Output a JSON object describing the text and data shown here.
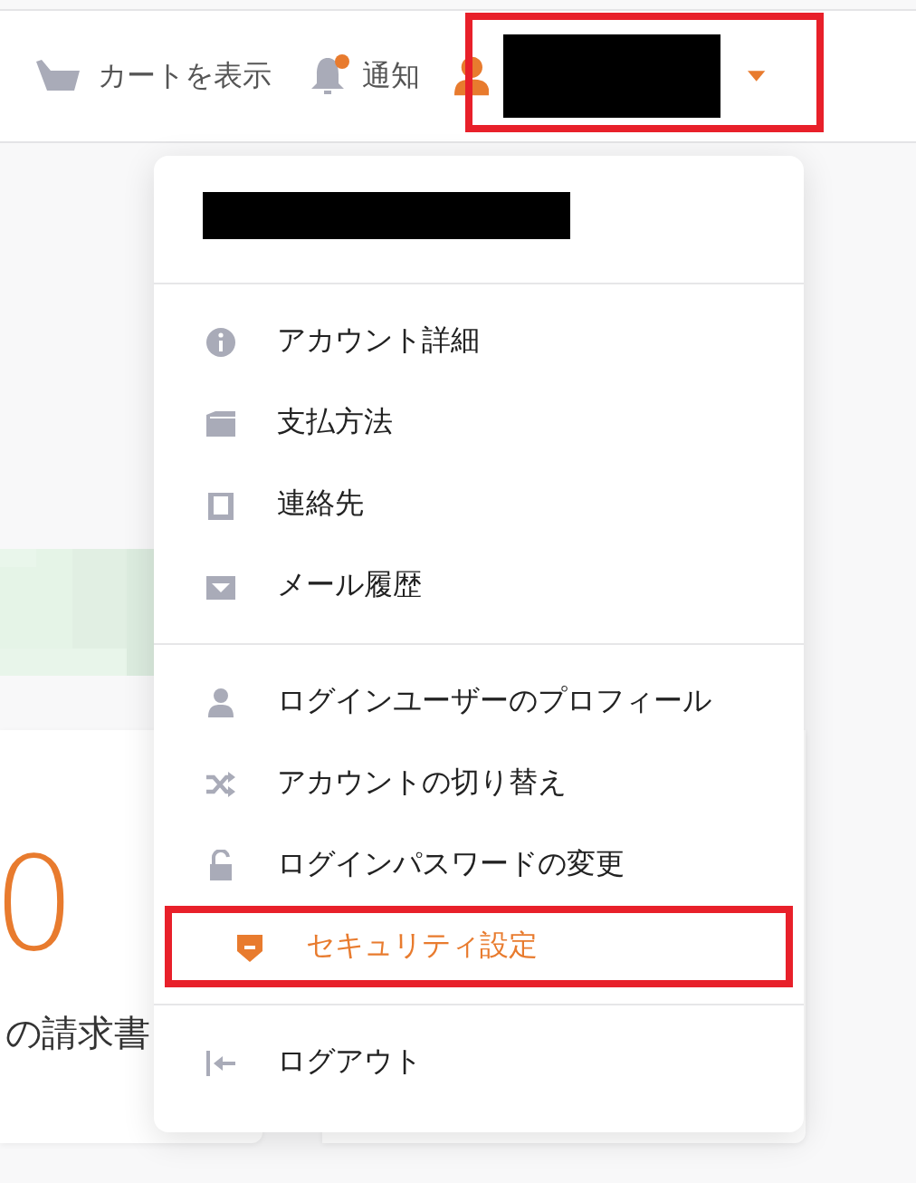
{
  "top_bar": {
    "cart": {
      "label": "カートを表示"
    },
    "notifications": {
      "label": "通知",
      "unread": true
    },
    "user_menu": {
      "redacted": true,
      "expanded": true,
      "highlighted": true
    }
  },
  "background": {
    "card": {
      "value": "0",
      "label": "の請求書"
    }
  },
  "dropdown": {
    "header": {
      "redacted": true
    },
    "groups": [
      [
        {
          "kind": "info",
          "label": "アカウント詳細",
          "selected": false,
          "highlighted": false
        },
        {
          "kind": "wallet",
          "label": "支払方法",
          "selected": false,
          "highlighted": false
        },
        {
          "kind": "contact",
          "label": "連絡先",
          "selected": false,
          "highlighted": false
        },
        {
          "kind": "mail",
          "label": "メール履歴",
          "selected": false,
          "highlighted": false
        }
      ],
      [
        {
          "kind": "user",
          "label": "ログインユーザーのプロフィール",
          "selected": false,
          "highlighted": false
        },
        {
          "kind": "shuffle",
          "label": "アカウントの切り替え",
          "selected": false,
          "highlighted": false
        },
        {
          "kind": "lock",
          "label": "ログインパスワードの変更",
          "selected": false,
          "highlighted": false
        },
        {
          "kind": "shield",
          "label": "セキュリティ設定",
          "selected": true,
          "highlighted": true
        }
      ],
      [
        {
          "kind": "logout",
          "label": "ログアウト",
          "selected": false,
          "highlighted": false
        }
      ]
    ]
  }
}
